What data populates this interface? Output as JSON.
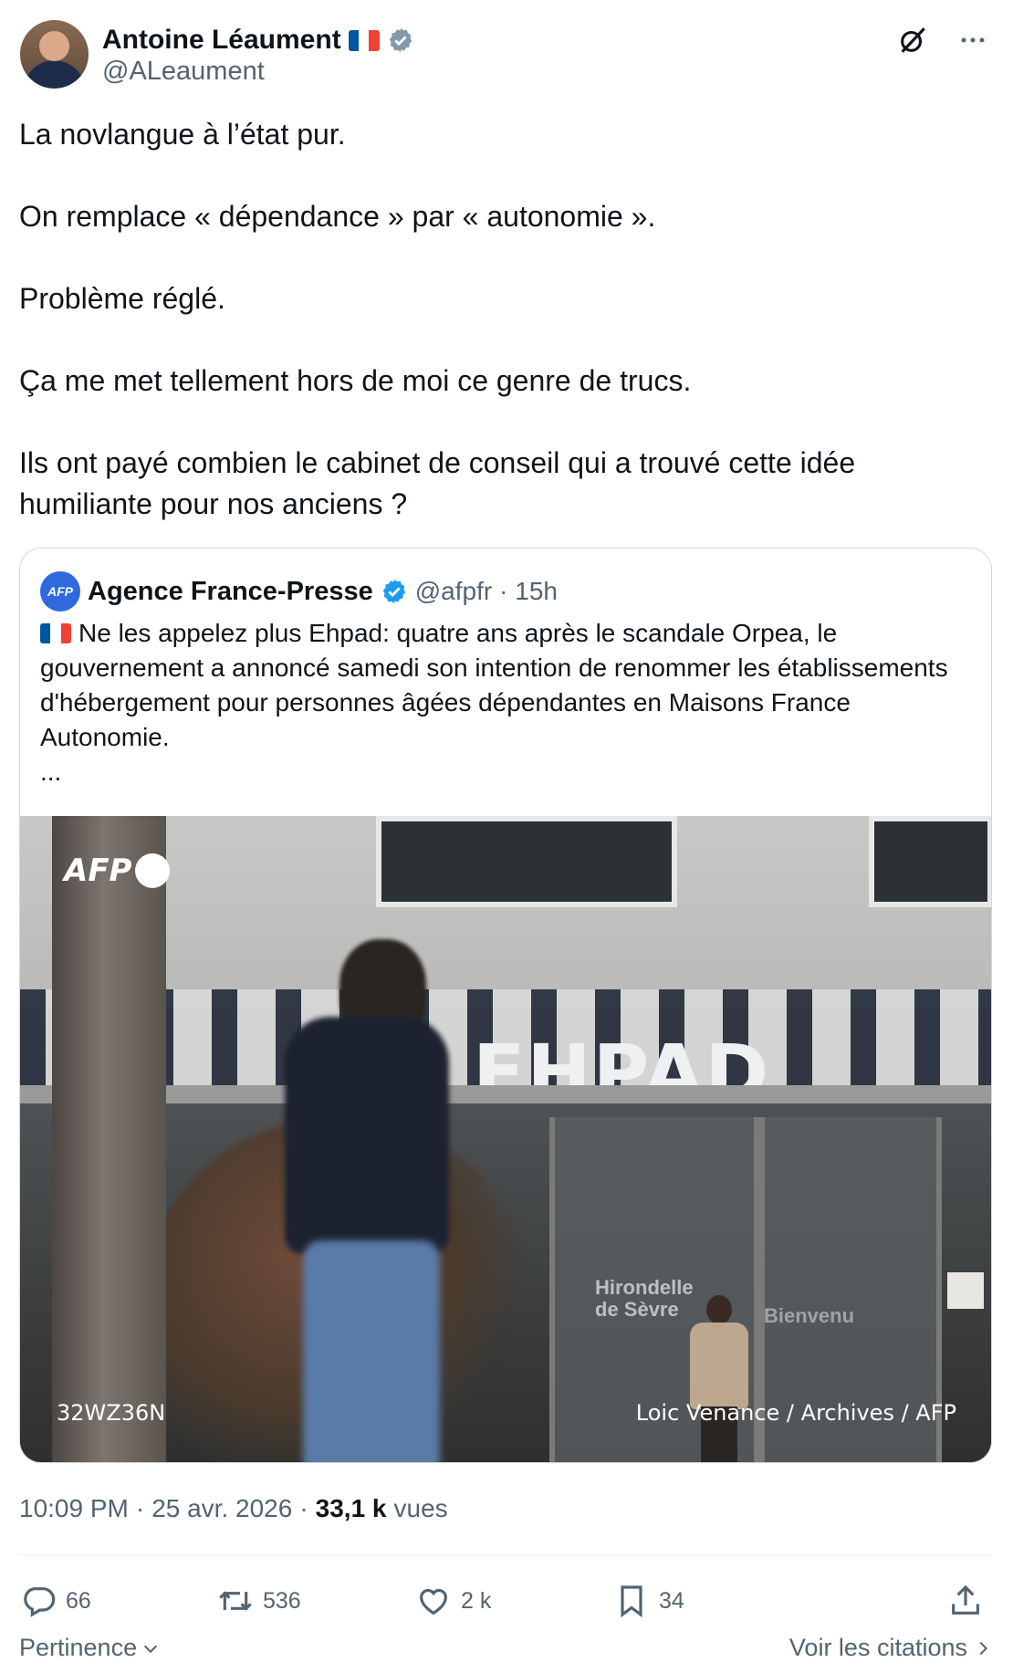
{
  "colors": {
    "accent": "#1d9bf0",
    "text_primary": "#0f1419",
    "text_secondary": "#536471",
    "border": "#cfd9de",
    "flag_blue": "#0055a4",
    "flag_white": "#ffffff",
    "flag_red": "#ef4135"
  },
  "author": {
    "display_name": "Antoine Léaument",
    "handle": "@ALeaument",
    "flag_icon": "france-flag-icon",
    "verified_icon": "verified-badge-icon"
  },
  "top_actions": {
    "grok_icon": "grok-icon",
    "more_icon": "more-options-icon"
  },
  "tweet": {
    "text": "La novlangue à l’état pur.\n\nOn remplace « dépendance » par « autonomie ».\n\nProblème réglé.\n\nÇa me met tellement hors de moi ce genre de trucs.\n\nIls ont payé combien le cabinet de conseil qui a trouvé cette idée humiliante pour nos anciens ?"
  },
  "quote": {
    "avatar_text": "AFP",
    "display_name": "Agence France-Presse",
    "handle": "@afpfr",
    "time": "· 15h",
    "text": "Ne les appelez plus Ehpad: quatre ans après le scandale Orpea, le gouvernement a annoncé samedi son intention de renommer les établissements d'hébergement pour personnes âgées dépendantes en Maisons France Autonomie.\n...",
    "photo": {
      "watermark": "AFP",
      "sign_text": "EHPAD",
      "glass_text_1": "Hirondelle\nde Sèvre",
      "glass_text_2": "Bienvenu",
      "photo_id": "32WZ36N",
      "credit": "Loic Venance / Archives / AFP"
    }
  },
  "meta": {
    "time": "10:09 PM",
    "separator": "·",
    "date": "25 avr. 2026",
    "separator2": "·",
    "views_count": "33,1 k",
    "views_label": "vues"
  },
  "actions": {
    "replies": "66",
    "retweets": "536",
    "likes": "2 k",
    "bookmarks": "34"
  },
  "footer": {
    "sort_label": "Pertinence",
    "quotes_link": "Voir les citations"
  }
}
